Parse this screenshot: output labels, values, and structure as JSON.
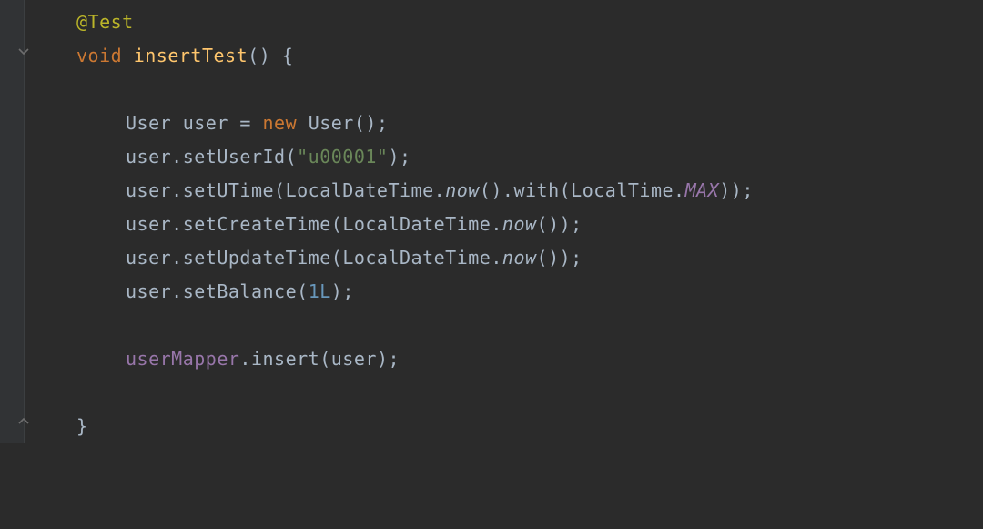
{
  "annotation": "@Test",
  "kw_void": "void",
  "method_name": "insertTest",
  "paren_open": "(",
  "paren_close": ")",
  "brace_open": "{",
  "brace_close": "}",
  "User": "User",
  "var_user": "user",
  "eq": " = ",
  "kw_new": "new",
  "space": " ",
  "semi": ";",
  "dot": ".",
  "comma": ", ",
  "setUserId": "setUserId",
  "str_userid": "\"u00001\"",
  "setUTime": "setUTime",
  "LocalDateTime": "LocalDateTime",
  "now": "now",
  "with": "with",
  "LocalTime": "LocalTime",
  "MAX": "MAX",
  "setCreateTime": "setCreateTime",
  "setUpdateTime": "setUpdateTime",
  "setBalance": "setBalance",
  "balance_val": "1L",
  "userMapper": "userMapper",
  "insert": "insert"
}
